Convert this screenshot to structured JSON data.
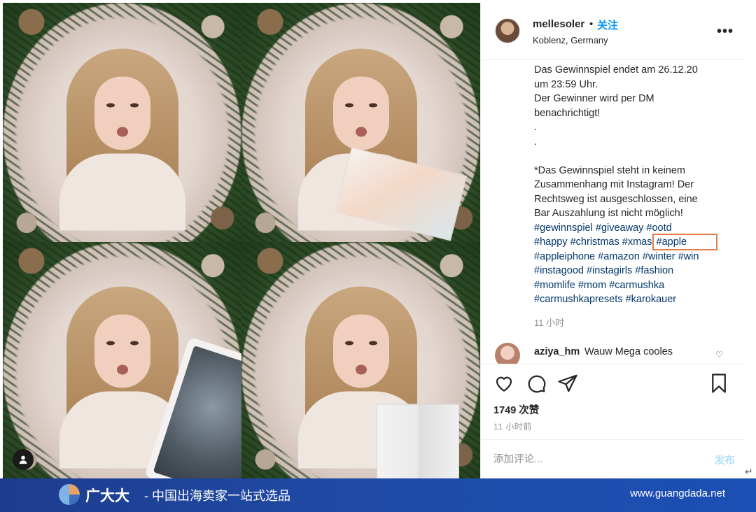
{
  "post": {
    "username": "mellesoler",
    "separator": "•",
    "follow_label": "关注",
    "location": "Koblenz, Germany",
    "more_label": "•••"
  },
  "caption": {
    "lines": [
      "Das Gewinnspiel endet am 26.12.20",
      "um 23:59 Uhr.",
      "Der Gewinner wird per DM",
      "benachrichtigt!",
      ".",
      ".",
      "",
      "*Das Gewinnspiel steht in keinem",
      "Zusammenhang mit Instagram! Der",
      "Rechtsweg ist ausgeschlossen, eine",
      "Bar Auszahlung ist nicht möglich!"
    ],
    "hashtag_lines": [
      [
        "#gewinnspiel",
        "#giveaway",
        "#ootd"
      ],
      [
        "#happy",
        "#christmas",
        "#xmas",
        "#apple"
      ],
      [
        "#appleiphone",
        "#amazon",
        "#winter",
        "#win"
      ],
      [
        "#instagood",
        "#instagirls",
        "#fashion"
      ],
      [
        "#momlife",
        "#mom",
        "#carmushka"
      ],
      [
        "#carmushkapresets",
        "#karokauer"
      ]
    ],
    "highlighted_tag": "#apple",
    "age": "11 小时"
  },
  "comment": {
    "user": "aziya_hm",
    "text": "Wauw Mega cooles",
    "heart_icon": "heart-outline-icon"
  },
  "actions": {
    "like_icon": "heart-outline-icon",
    "comment_icon": "comment-bubble-icon",
    "share_icon": "paper-plane-icon",
    "save_icon": "bookmark-icon",
    "likes": "1749 次赞",
    "posted": "11 小时前"
  },
  "add_comment": {
    "placeholder": "添加评论...",
    "post_label": "发布"
  },
  "banner": {
    "brand": "广大大",
    "slogan": "- 中国出海卖家一站式选品",
    "site": "www.guangdada.net"
  },
  "colors": {
    "link_blue": "#0095f6",
    "hashtag": "#00376b",
    "highlight_box": "#e47d4b",
    "banner_blue": "#1f4aa5"
  }
}
